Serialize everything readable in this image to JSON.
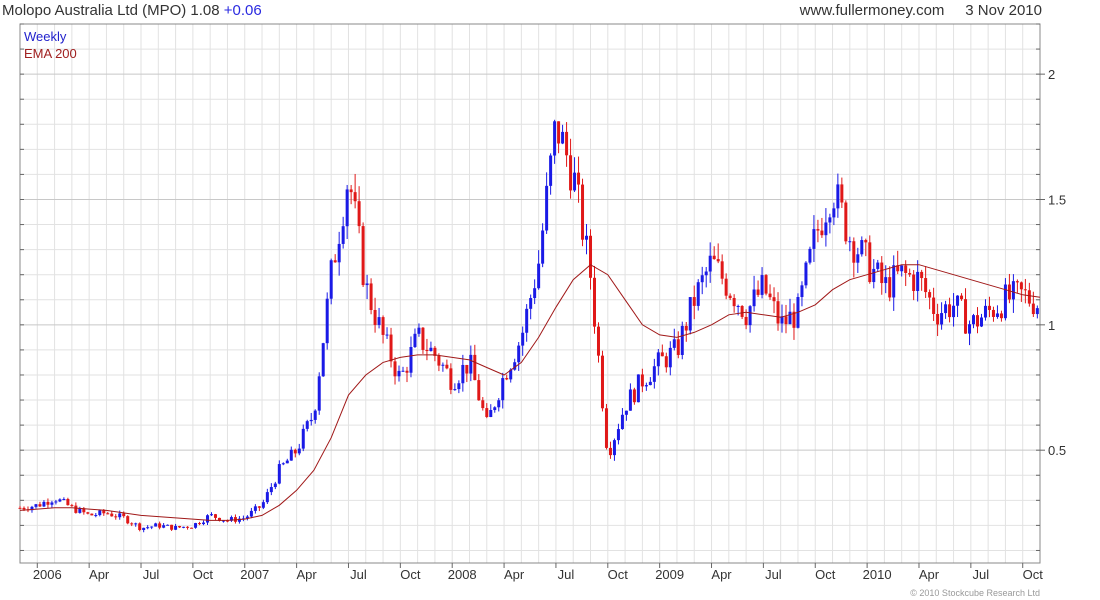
{
  "header": {
    "title": "Molopo Australia Ltd (MPO) 1.08",
    "change": "+0.06",
    "source": "www.fullermoney.com",
    "date": "3 Nov 2010"
  },
  "credit": "© 2010 Stockcube Research Ltd",
  "colors": {
    "up": "#1a1ae6",
    "down": "#e01818",
    "ema": "#a01818",
    "grid": "#e2e2e2",
    "legend_weekly": "#2222cc",
    "legend_ema": "#a02020"
  },
  "chart_data": {
    "type": "candlestick",
    "title": "",
    "legend": {
      "placement": "top-left",
      "entries": [
        "Weekly",
        "EMA 200"
      ]
    },
    "x_tick_labels": [
      "2006",
      "Apr",
      "Jul",
      "Oct",
      "2007",
      "Apr",
      "Jul",
      "Oct",
      "2008",
      "Apr",
      "Jul",
      "Oct",
      "2009",
      "Apr",
      "Jul",
      "Oct",
      "2010",
      "Apr",
      "Jul",
      "Oct"
    ],
    "x_tick_dates": [
      "2006-01",
      "2006-04",
      "2006-07",
      "2006-10",
      "2007-01",
      "2007-04",
      "2007-07",
      "2007-10",
      "2008-01",
      "2008-04",
      "2008-07",
      "2008-10",
      "2009-01",
      "2009-04",
      "2009-07",
      "2009-10",
      "2010-01",
      "2010-04",
      "2010-07",
      "2010-10"
    ],
    "xlim": [
      "2005-12",
      "2010-11"
    ],
    "y_ticks": [
      0.5,
      1,
      1.5,
      2
    ],
    "y_tick_labels": [
      "0.5",
      "1",
      "1.5",
      "2"
    ],
    "y_axis_side": "right",
    "ylim": [
      0.05,
      2.2
    ],
    "grid": true,
    "series": [
      {
        "name": "Weekly",
        "kind": "close_path",
        "x": [
          "2005-12",
          "2006-01",
          "2006-02",
          "2006-03",
          "2006-04",
          "2006-05",
          "2006-06",
          "2006-07",
          "2006-08",
          "2006-09",
          "2006-10",
          "2006-11",
          "2006-12",
          "2007-01",
          "2007-02",
          "2007-03",
          "2007-04",
          "2007-05",
          "2007-06",
          "2007-07",
          "2007-08",
          "2007-09",
          "2007-10",
          "2007-11",
          "2007-12",
          "2008-01",
          "2008-02",
          "2008-03",
          "2008-04",
          "2008-05",
          "2008-06",
          "2008-07",
          "2008-08",
          "2008-09",
          "2008-10",
          "2008-11",
          "2008-12",
          "2009-01",
          "2009-02",
          "2009-03",
          "2009-04",
          "2009-05",
          "2009-06",
          "2009-07",
          "2009-08",
          "2009-09",
          "2009-10",
          "2009-11",
          "2009-12",
          "2010-01",
          "2010-02",
          "2010-03",
          "2010-04",
          "2010-05",
          "2010-06",
          "2010-07",
          "2010-08",
          "2010-09",
          "2010-10",
          "2010-11"
        ],
        "values": [
          0.27,
          0.28,
          0.31,
          0.27,
          0.24,
          0.25,
          0.23,
          0.19,
          0.2,
          0.19,
          0.2,
          0.24,
          0.22,
          0.23,
          0.28,
          0.42,
          0.5,
          0.65,
          1.2,
          1.6,
          1.15,
          0.95,
          0.78,
          0.95,
          0.88,
          0.78,
          0.85,
          0.6,
          0.8,
          0.95,
          1.25,
          1.8,
          1.6,
          1.2,
          0.48,
          0.68,
          0.78,
          0.85,
          0.9,
          1.1,
          1.25,
          1.15,
          1.05,
          1.15,
          1.0,
          1.05,
          1.35,
          1.55,
          1.35,
          1.25,
          1.15,
          1.2,
          1.18,
          1.05,
          1.08,
          1.0,
          1.05,
          1.1,
          1.12,
          1.08
        ]
      },
      {
        "name": "EMA 200",
        "kind": "line",
        "x": [
          "2005-12",
          "2006-01",
          "2006-02",
          "2006-03",
          "2006-04",
          "2006-05",
          "2006-06",
          "2006-07",
          "2006-08",
          "2006-09",
          "2006-10",
          "2006-11",
          "2006-12",
          "2007-01",
          "2007-02",
          "2007-03",
          "2007-04",
          "2007-05",
          "2007-06",
          "2007-07",
          "2007-08",
          "2007-09",
          "2007-10",
          "2007-11",
          "2007-12",
          "2008-01",
          "2008-02",
          "2008-03",
          "2008-04",
          "2008-05",
          "2008-06",
          "2008-07",
          "2008-08",
          "2008-09",
          "2008-10",
          "2008-11",
          "2008-12",
          "2009-01",
          "2009-02",
          "2009-03",
          "2009-04",
          "2009-05",
          "2009-06",
          "2009-07",
          "2009-08",
          "2009-09",
          "2009-10",
          "2009-11",
          "2009-12",
          "2010-01",
          "2010-02",
          "2010-03",
          "2010-04",
          "2010-05",
          "2010-06",
          "2010-07",
          "2010-08",
          "2010-09",
          "2010-10",
          "2010-11"
        ],
        "values": [
          0.26,
          0.265,
          0.27,
          0.27,
          0.265,
          0.26,
          0.25,
          0.24,
          0.235,
          0.23,
          0.225,
          0.22,
          0.22,
          0.225,
          0.24,
          0.28,
          0.34,
          0.42,
          0.55,
          0.72,
          0.8,
          0.85,
          0.87,
          0.88,
          0.88,
          0.87,
          0.86,
          0.83,
          0.8,
          0.85,
          0.95,
          1.07,
          1.18,
          1.24,
          1.2,
          1.1,
          1.0,
          0.96,
          0.95,
          0.97,
          1.0,
          1.04,
          1.05,
          1.04,
          1.03,
          1.05,
          1.08,
          1.14,
          1.18,
          1.2,
          1.22,
          1.24,
          1.24,
          1.22,
          1.2,
          1.18,
          1.16,
          1.14,
          1.12,
          1.11
        ]
      }
    ]
  }
}
